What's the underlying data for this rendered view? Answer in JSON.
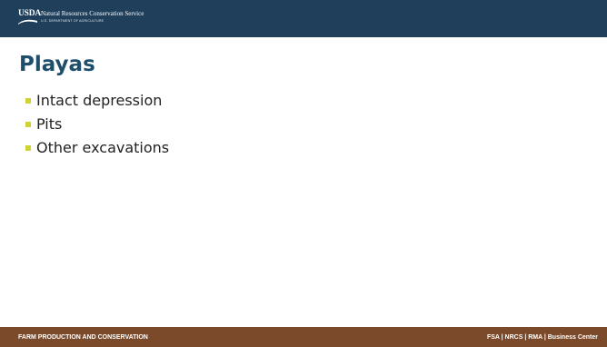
{
  "header": {
    "logo_text": "USDA",
    "agency": "Natural Resources Conservation Service",
    "department": "U.S. DEPARTMENT OF AGRICULTURE"
  },
  "slide": {
    "title": "Playas",
    "bullets": [
      "Intact depression",
      "Pits",
      "Other excavations"
    ]
  },
  "footer": {
    "left": "FARM PRODUCTION AND CONSERVATION",
    "right": "FSA | NRCS | RMA | Business Center"
  },
  "colors": {
    "header_background": "#1f3f5a",
    "title": "#1f4e6b",
    "bullet_marker": "#d0d335",
    "footer_background": "#7a4a2b"
  }
}
